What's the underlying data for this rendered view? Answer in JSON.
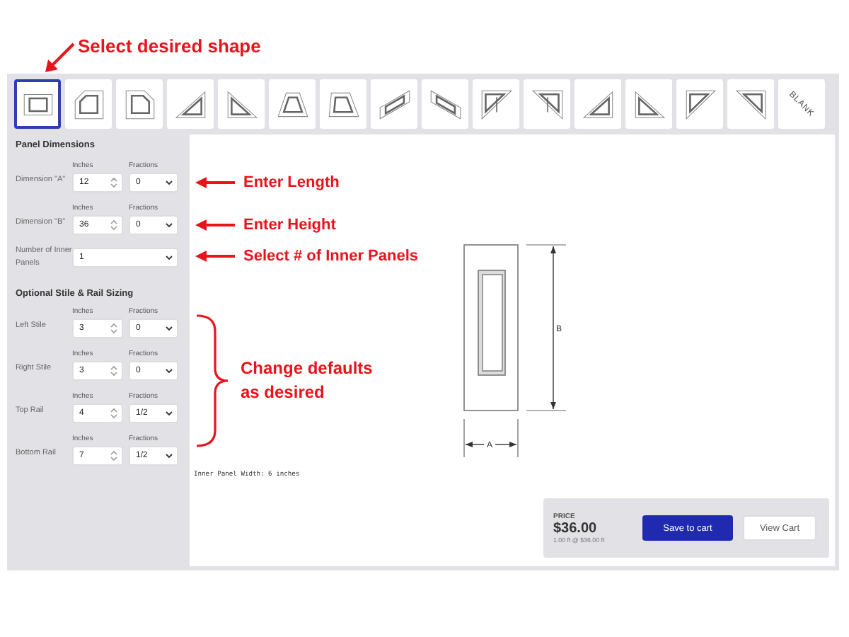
{
  "shape_callout": "Select desired shape",
  "shapes": [
    {
      "kind": "rect",
      "selected": true
    },
    {
      "kind": "chamfer-left",
      "selected": false
    },
    {
      "kind": "chamfer-right",
      "selected": false
    },
    {
      "kind": "triangle-left",
      "selected": false
    },
    {
      "kind": "triangle-right",
      "selected": false
    },
    {
      "kind": "trapezoid",
      "selected": false
    },
    {
      "kind": "trapezoid-right",
      "selected": false
    },
    {
      "kind": "parallelogram-up",
      "selected": false
    },
    {
      "kind": "parallelogram-down",
      "selected": false
    },
    {
      "kind": "split-up",
      "selected": false
    },
    {
      "kind": "split-down",
      "selected": false
    },
    {
      "kind": "triangle-left",
      "selected": false
    },
    {
      "kind": "triangle-right",
      "selected": false
    },
    {
      "kind": "inverted-left",
      "selected": false
    },
    {
      "kind": "inverted-right",
      "selected": false
    },
    {
      "kind": "blank",
      "label": "BLANK",
      "selected": false
    }
  ],
  "panel_dimensions": {
    "title": "Panel Dimensions",
    "rows": [
      {
        "kind": "dimension",
        "label": "Dimension \"A\"",
        "inches_label": "Inches",
        "inches": "12",
        "fractions_label": "Fractions",
        "fraction": "0",
        "note": "Enter Length"
      },
      {
        "kind": "dimension",
        "label": "Dimension \"B\"",
        "inches_label": "Inches",
        "inches": "36",
        "fractions_label": "Fractions",
        "fraction": "0",
        "note": "Enter Height"
      },
      {
        "kind": "select",
        "label": "Number of Inner Panels",
        "value": "1",
        "note": "Select # of Inner Panels"
      }
    ]
  },
  "stile_rail": {
    "title": "Optional Stile & Rail Sizing",
    "note": "Change defaults as desired",
    "rows": [
      {
        "kind": "dimension",
        "label": "Left Stile",
        "inches_label": "Inches",
        "inches": "3",
        "fractions_label": "Fractions",
        "fraction": "0"
      },
      {
        "kind": "dimension",
        "label": "Right Stile",
        "inches_label": "Inches",
        "inches": "3",
        "fractions_label": "Fractions",
        "fraction": "0"
      },
      {
        "kind": "dimension",
        "label": "Top Rail",
        "inches_label": "Inches",
        "inches": "4",
        "fractions_label": "Fractions",
        "fraction": "1/2"
      },
      {
        "kind": "dimension",
        "label": "Bottom Rail",
        "inches_label": "Inches",
        "inches": "7",
        "fractions_label": "Fractions",
        "fraction": "1/2"
      }
    ]
  },
  "preview": {
    "width_label": "A",
    "height_label": "B",
    "inner_panel_note": "Inner Panel Width: 6 inches"
  },
  "price": {
    "label": "PRICE",
    "amount": "$36.00",
    "detail": "1.00 ft @ $36.00 ft",
    "buttons": [
      {
        "kind": "primary",
        "label": "Save to cart"
      },
      {
        "kind": "secondary",
        "label": "View Cart"
      }
    ]
  }
}
